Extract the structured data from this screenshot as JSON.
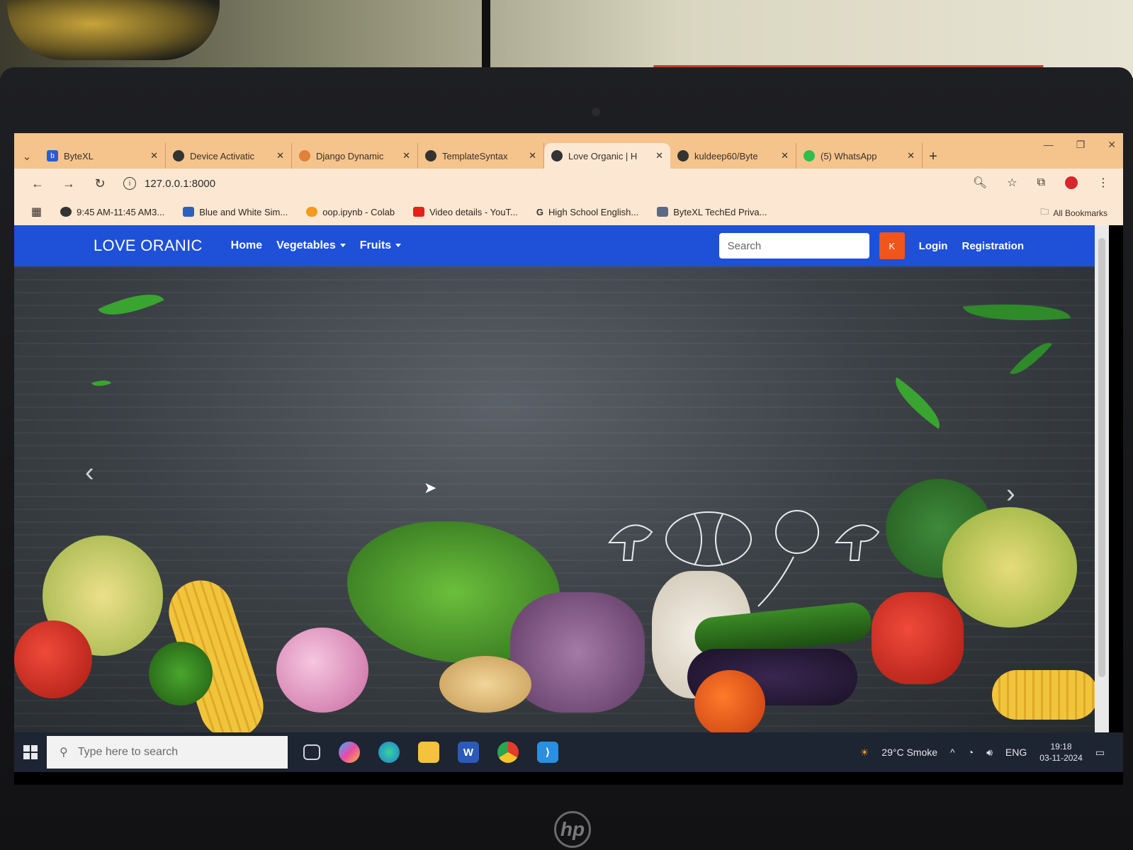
{
  "browser": {
    "tabs": [
      {
        "title": "ByteXL",
        "icon": "bytexl-icon",
        "active": false
      },
      {
        "title": "Device Activatic",
        "icon": "github-icon",
        "active": false
      },
      {
        "title": "Django Dynamic",
        "icon": "django-icon",
        "active": false
      },
      {
        "title": "TemplateSyntax",
        "icon": "globe-icon",
        "active": false
      },
      {
        "title": "Love Organic | H",
        "icon": "globe-icon",
        "active": true
      },
      {
        "title": "kuldeep60/Byte",
        "icon": "github-icon",
        "active": false
      },
      {
        "title": "(5) WhatsApp",
        "icon": "whatsapp-icon",
        "active": false
      }
    ],
    "address": "127.0.0.1:8000",
    "bookmarks": [
      {
        "label": "9:45 AM-11:45 AM3...",
        "icon": "globe-icon",
        "color": "#333333"
      },
      {
        "label": "Blue and White Sim...",
        "icon": "printer-icon",
        "color": "#2d5fbf"
      },
      {
        "label": "oop.ipynb - Colab",
        "icon": "colab-icon",
        "color": "#f29b1d"
      },
      {
        "label": "Video details - YouT...",
        "icon": "youtube-icon",
        "color": "#e62117"
      },
      {
        "label": "High School English...",
        "icon": "google-icon",
        "color": "#4285f4"
      },
      {
        "label": "ByteXL TechEd Priva...",
        "icon": "document-icon",
        "color": "#5b6b85"
      }
    ],
    "all_bookmarks": "All Bookmarks"
  },
  "site": {
    "brand": "LOVE ORANIC",
    "nav": {
      "home": "Home",
      "vegetables": "Vegetables",
      "fruits": "Fruits"
    },
    "search_placeholder": "Search",
    "search_button": "K",
    "login": "Login",
    "registration": "Registration",
    "accent": "#1e50d8",
    "button_color": "#f0551c"
  },
  "taskbar": {
    "search_placeholder": "Type here to search",
    "weather": "29°C  Smoke",
    "language": "ENG",
    "time": "19:18",
    "date": "03-11-2024"
  }
}
